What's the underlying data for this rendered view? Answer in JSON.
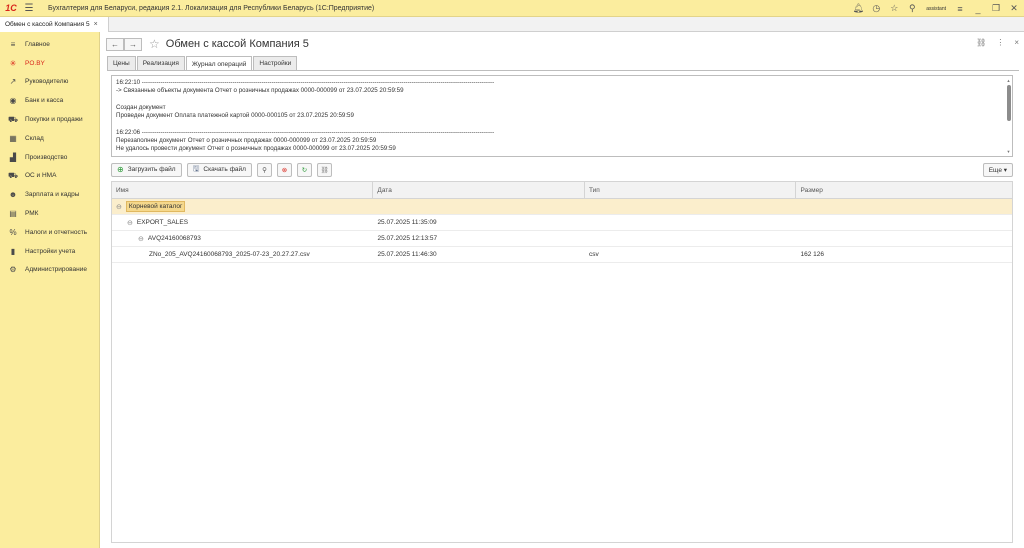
{
  "titlebar": {
    "logo": "1С",
    "title": "Бухгалтерия для Беларуси, редакция 2.1. Локализация для Республики Беларусь   (1С:Предприятие)",
    "user": "assistant"
  },
  "tabs_open": [
    {
      "label": "Обмен с кассой Компания 5",
      "close": "×"
    }
  ],
  "sidebar": {
    "items": [
      {
        "label": "Главное",
        "icon": "hamburger-icon",
        "glyph": "≡"
      },
      {
        "label": "PO.BY",
        "icon": "asterisk-icon",
        "glyph": "✳"
      },
      {
        "label": "Руководителю",
        "icon": "chart-line-icon",
        "glyph": "↗"
      },
      {
        "label": "Банк и касса",
        "icon": "bank-icon",
        "glyph": "◉"
      },
      {
        "label": "Покупки и продажи",
        "icon": "cart-icon",
        "glyph": "⛟"
      },
      {
        "label": "Склад",
        "icon": "warehouse-icon",
        "glyph": "▦"
      },
      {
        "label": "Производство",
        "icon": "factory-icon",
        "glyph": "▟"
      },
      {
        "label": "ОС и НМА",
        "icon": "truck-icon",
        "glyph": "⛟"
      },
      {
        "label": "Зарплата и кадры",
        "icon": "people-icon",
        "glyph": "☻"
      },
      {
        "label": "РМК",
        "icon": "register-icon",
        "glyph": "▤"
      },
      {
        "label": "Налоги и отчетность",
        "icon": "percent-icon",
        "glyph": "%"
      },
      {
        "label": "Настройки учета",
        "icon": "book-icon",
        "glyph": "▮"
      },
      {
        "label": "Администрирование",
        "icon": "gear-icon",
        "glyph": "⚙"
      }
    ]
  },
  "form": {
    "title": "Обмен с кассой Компания 5",
    "tabs": [
      {
        "label": "Цены",
        "active": false
      },
      {
        "label": "Реализация",
        "active": false
      },
      {
        "label": "Журнал операций",
        "active": true
      },
      {
        "label": "Настройки",
        "active": false
      }
    ]
  },
  "log": {
    "lines": [
      "16:22:10 ---------------------------------------------------------------------------------------------------------------------------------------------------------------------------",
      "-> Связанные объекты документа Отчет о розничных продажах 0000-000099 от 23.07.2025 20:59:59",
      "",
      "Создан документ",
      "Проведен документ Оплата платежной картой 0000-000105 от 23.07.2025 20:59:59",
      "",
      "16:22:06 ---------------------------------------------------------------------------------------------------------------------------------------------------------------------------",
      "Перезаполнен документ Отчет о розничных продажах 0000-000099 от 23.07.2025 20:59:59",
      "Не удалось провести документ Отчет о розничных продажах 0000-000099 от 23.07.2025 20:59:59"
    ]
  },
  "toolbar": {
    "upload_label": "Загрузить файл",
    "download_label": "Скачать файл",
    "more_label": "Еще ▾"
  },
  "grid": {
    "columns": [
      "Имя",
      "Дата",
      "Тип",
      "Размер"
    ],
    "rows": [
      {
        "name": "Корневой каталог",
        "date": "",
        "type": "",
        "size": "",
        "level": 0,
        "selected": true
      },
      {
        "name": "EXPORT_SALES",
        "date": "25.07.2025 11:35:09",
        "type": "",
        "size": "",
        "level": 1,
        "selected": false
      },
      {
        "name": "AVQ24160068793",
        "date": "25.07.2025 12:13:57",
        "type": "",
        "size": "",
        "level": 2,
        "selected": false
      },
      {
        "name": "ZNo_205_AVQ24160068793_2025-07-23_20.27.27.csv",
        "date": "25.07.2025 11:46:30",
        "type": "csv",
        "size": "162 126",
        "level": 3,
        "selected": false
      }
    ]
  },
  "colors": {
    "accent": "#fbed9e",
    "selection": "#fbeecc",
    "brand_red": "#d9261c"
  }
}
